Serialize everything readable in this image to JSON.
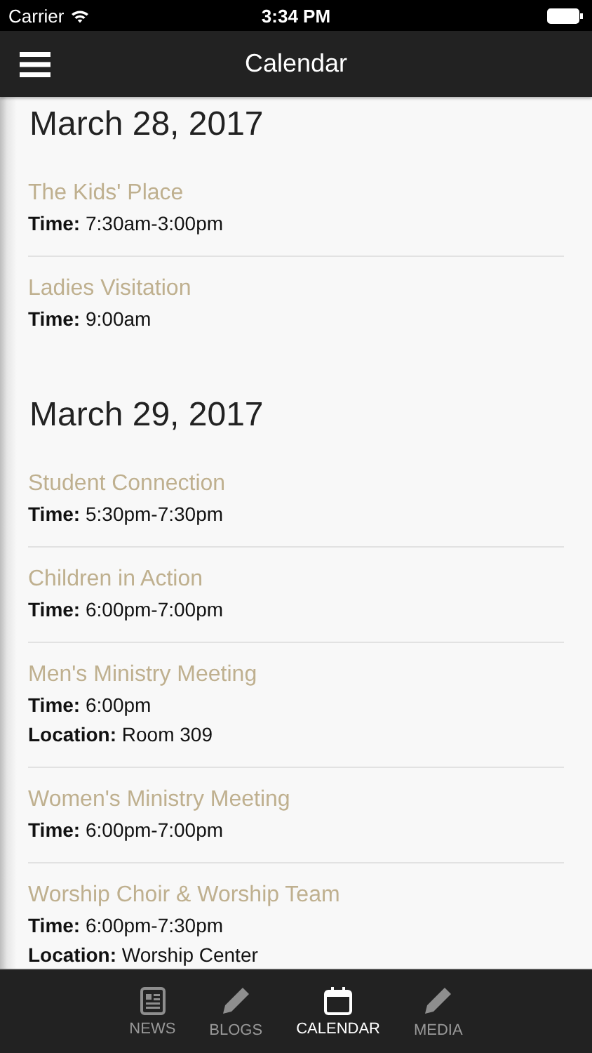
{
  "status_bar": {
    "carrier": "Carrier",
    "time": "3:34 PM"
  },
  "nav": {
    "title": "Calendar"
  },
  "days": [
    {
      "date": "March 28, 2017",
      "events": [
        {
          "title": "The Kids' Place",
          "details": [
            "**Time:** 7:30am-3:00pm"
          ]
        },
        {
          "title": "Ladies Visitation",
          "details": [
            "**Time:** 9:00am"
          ]
        }
      ]
    },
    {
      "date": "March 29, 2017",
      "events": [
        {
          "title": "Student Connection",
          "details": [
            "**Time:** 5:30pm-7:30pm"
          ]
        },
        {
          "title": "Children in Action",
          "details": [
            "**Time:** 6:00pm-7:00pm"
          ]
        },
        {
          "title": "Men's Ministry Meeting",
          "details": [
            "**Time:** 6:00pm",
            "**Location:** Room 309"
          ]
        },
        {
          "title": "Women's Ministry Meeting",
          "details": [
            "**Time:** 6:00pm-7:00pm"
          ]
        },
        {
          "title": "Worship Choir & Worship Team",
          "details": [
            "**Time:** 6:00pm-7:30pm",
            "**Location:** Worship Center"
          ]
        }
      ]
    }
  ],
  "tabs": [
    {
      "label": "NEWS",
      "kind": "news",
      "selected": false
    },
    {
      "label": "BLOGS",
      "kind": "pencil",
      "selected": false
    },
    {
      "label": "CALENDAR",
      "kind": "calendar",
      "selected": true
    },
    {
      "label": "MEDIA",
      "kind": "pencil",
      "selected": false
    }
  ]
}
